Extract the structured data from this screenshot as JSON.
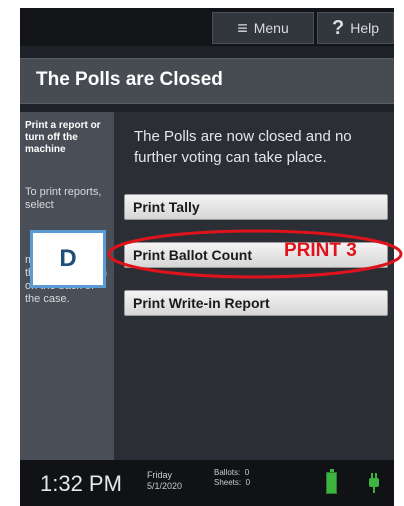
{
  "topbar": {
    "menu_label": "Menu",
    "help_label": "Help"
  },
  "title": "The Polls are Closed",
  "sidebar": {
    "heading": "Print a report or turn off the machine",
    "print_text": "To print reports, select",
    "off_text": "machine, push the power button on the back of the case."
  },
  "main": {
    "message": "The Polls are now closed and no further voting can take place.",
    "buttons": [
      "Print Tally",
      "Print Ballot Count",
      "Print Write-in Report"
    ]
  },
  "status": {
    "time": "1:32 PM",
    "day": "Friday",
    "date": "5/1/2020",
    "ballots_label": "Ballots:",
    "ballots_value": "0",
    "sheets_label": "Sheets:",
    "sheets_value": "0"
  },
  "annotations": {
    "marker": "D",
    "print_note": "PRINT 3"
  },
  "colors": {
    "battery": "#3fb33f",
    "annotation_red": "#e0121b",
    "marker_border": "#5b9bd5"
  },
  "icons": {
    "menu": "hamburger-icon",
    "help": "question-icon",
    "battery": "battery-icon",
    "power": "plug-icon"
  }
}
